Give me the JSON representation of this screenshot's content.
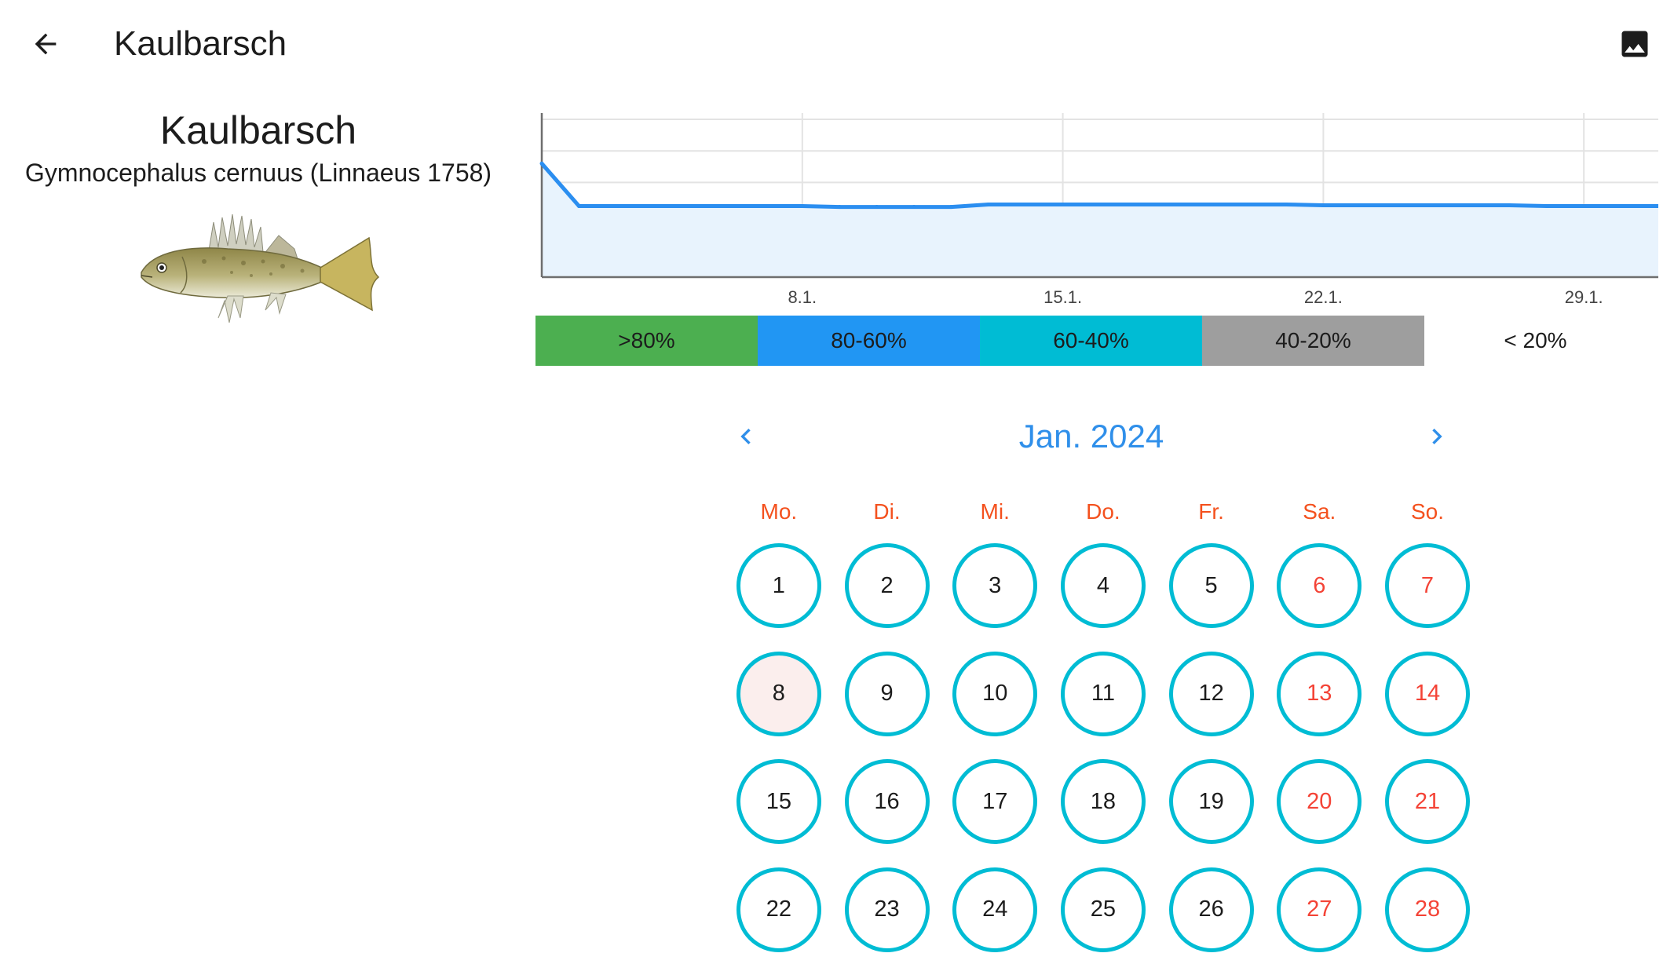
{
  "appbar": {
    "title": "Kaulbarsch",
    "back_icon": "arrow-back-icon",
    "image_icon": "image-icon"
  },
  "species": {
    "common_name": "Kaulbarsch",
    "scientific_name": "Gymnocephalus cernuus (Linnaeus 1758)"
  },
  "chart_data": {
    "type": "area",
    "x": [
      1,
      2,
      3,
      4,
      5,
      6,
      7,
      8,
      9,
      10,
      11,
      12,
      13,
      14,
      15,
      16,
      17,
      18,
      19,
      20,
      21,
      22,
      23,
      24,
      25,
      26,
      27,
      28,
      29,
      30,
      31
    ],
    "values": [
      72,
      45,
      45,
      45,
      45,
      45,
      45,
      45,
      44.5,
      44.5,
      44.5,
      44.5,
      46,
      46,
      46,
      46,
      46,
      46,
      46,
      46,
      46,
      45.5,
      45.5,
      45.5,
      45.5,
      45.5,
      45.5,
      45,
      45,
      45,
      45
    ],
    "x_tick_labels": [
      "8.1.",
      "15.1.",
      "22.1.",
      "29.1."
    ],
    "x_tick_positions": [
      8,
      15,
      22,
      29
    ],
    "xlim": [
      1,
      31
    ],
    "ylim": [
      0,
      100
    ],
    "grid": true,
    "line_color": "#2b8ef0",
    "fill_color": "#e8f3fd"
  },
  "legend": [
    {
      "label": ">80%",
      "color": "#4caf50"
    },
    {
      "label": "80-60%",
      "color": "#2196f3"
    },
    {
      "label": "60-40%",
      "color": "#00bcd4"
    },
    {
      "label": "40-20%",
      "color": "#9e9e9e"
    },
    {
      "label": "< 20%",
      "color": "#ffffff"
    }
  ],
  "calendar": {
    "month_label": "Jan. 2024",
    "prev_icon": "chevron-left-icon",
    "next_icon": "chevron-right-icon",
    "weekdays": [
      "Mo.",
      "Di.",
      "Mi.",
      "Do.",
      "Fr.",
      "Sa.",
      "So."
    ],
    "days": [
      "1",
      "2",
      "3",
      "4",
      "5",
      "6",
      "7",
      "8",
      "9",
      "10",
      "11",
      "12",
      "13",
      "14",
      "15",
      "16",
      "17",
      "18",
      "19",
      "20",
      "21",
      "22",
      "23",
      "24",
      "25",
      "26",
      "27",
      "28"
    ],
    "highlighted_day": "8",
    "ring_color": "#00bcd4",
    "weekend_color": "#f44336",
    "accent_color": "#2f8fea"
  }
}
